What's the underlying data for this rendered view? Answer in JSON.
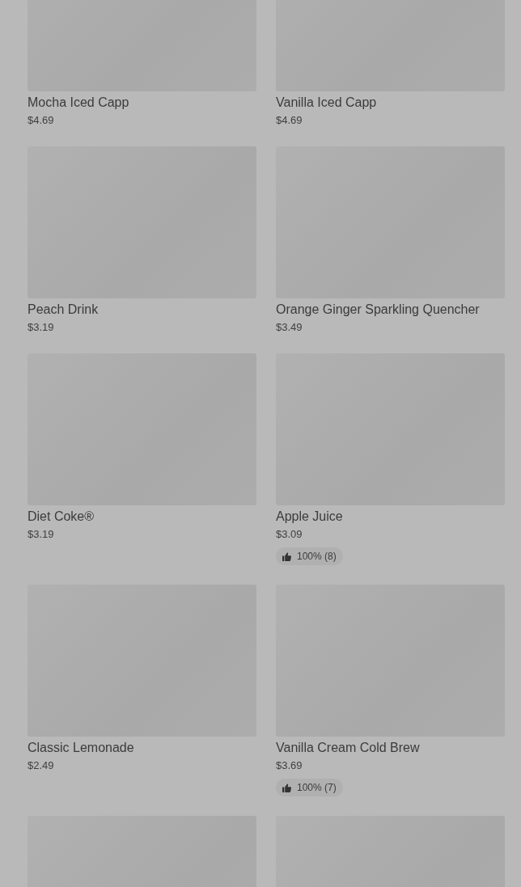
{
  "products": [
    {
      "kind": "full",
      "name": "Mocha Iced Capp",
      "price": "$4.69"
    },
    {
      "kind": "full",
      "name": "Vanilla Iced Capp",
      "price": "$4.69"
    },
    {
      "kind": "full",
      "name": "Peach Drink",
      "price": "$3.19"
    },
    {
      "kind": "full",
      "name": "Orange Ginger Sparkling Quencher",
      "price": "$3.49"
    },
    {
      "kind": "full",
      "name": "Diet Coke®",
      "price": "$3.19"
    },
    {
      "kind": "full",
      "name": "Apple Juice",
      "price": "$3.09",
      "rating": "100% (8)"
    },
    {
      "kind": "full",
      "name": "Classic Lemonade",
      "price": "$2.49"
    },
    {
      "kind": "full",
      "name": "Vanilla Cream Cold Brew",
      "price": "$3.69",
      "rating": "100% (7)"
    },
    {
      "kind": "image_only"
    },
    {
      "kind": "image_only"
    }
  ]
}
